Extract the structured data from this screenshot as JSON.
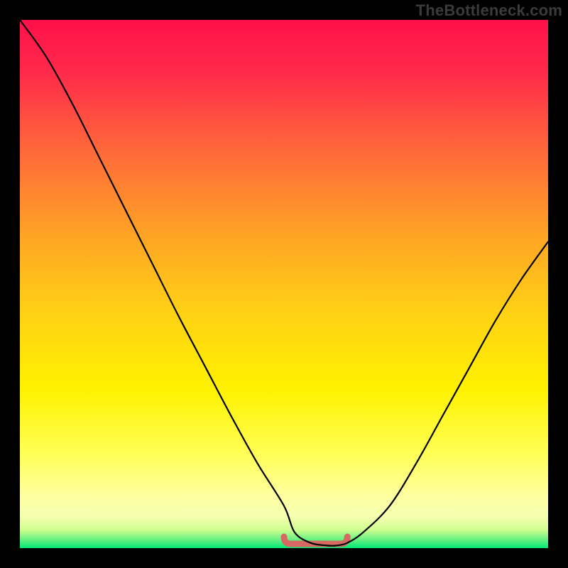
{
  "watermark": "TheBottleneck.com",
  "chart_data": {
    "type": "line",
    "title": "",
    "xlabel": "",
    "ylabel": "",
    "xlim": [
      0,
      100
    ],
    "ylim": [
      0,
      100
    ],
    "x": [
      0,
      5,
      10,
      15,
      20,
      25,
      30,
      35,
      40,
      45,
      50,
      52,
      55,
      58,
      60,
      62,
      65,
      70,
      75,
      80,
      85,
      90,
      95,
      100
    ],
    "values": [
      100,
      93,
      84,
      74,
      64,
      54,
      44,
      34.5,
      25,
      16,
      8,
      3,
      1,
      0.5,
      0.5,
      1,
      3,
      8,
      16,
      25,
      34,
      43,
      51,
      58
    ],
    "band_color_top": "#ff1a4e",
    "band_color_mid": "#ffd100",
    "band_color_low": "#ffff80",
    "band_color_bottom": "#00e878",
    "curve_color": "#000000",
    "valley_marker_color": "#d66a62",
    "valley_marker_x": [
      50,
      62
    ],
    "valley_marker_y": 0.8
  }
}
